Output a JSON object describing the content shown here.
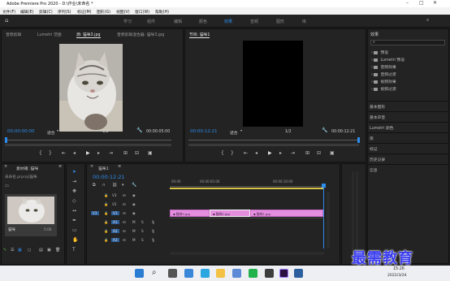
{
  "window": {
    "title": "Adobe Premiere Pro 2020 - D:\\作业\\未命名 *"
  },
  "menu": [
    "文件(F)",
    "编辑(E)",
    "剪辑(C)",
    "序列(S)",
    "标记(M)",
    "图形(G)",
    "视图(V)",
    "窗口(W)",
    "帮助(H)"
  ],
  "workspaces": [
    "学习",
    "组件",
    "编辑",
    "颜色",
    "效果",
    "音频",
    "图形",
    "库"
  ],
  "source_panel": {
    "tabs": [
      "音频剪辑",
      "Lumetri 范围",
      "源: 猫咪3.jpg",
      "音频剪辑混合器: 猫咪3.jpg"
    ],
    "timecode_in": "00:00:00:00",
    "fit": "适合",
    "fraction": "1/2",
    "timecode_out": "00:00:05:00"
  },
  "program_panel": {
    "tab": "节目: 猫咪1",
    "timecode_in": "00:00:12:21",
    "fit": "适合",
    "fraction": "1/2",
    "timecode_out": "00:00:12:21"
  },
  "effects_panel": {
    "title": "效果",
    "folders": [
      "预设",
      "Lumetri 预设",
      "音频效果",
      "音频过渡",
      "视频效果",
      "视频过渡"
    ],
    "sections": [
      "基本图形",
      "基本声音",
      "Lumetri 颜色",
      "库",
      "标记",
      "历史记录",
      "信息"
    ]
  },
  "project_panel": {
    "tab": "素材箱: 猫咪",
    "path": "未命名.prproj\\猫咪",
    "item_label": "猫咪",
    "item_duration": "5:00"
  },
  "timeline": {
    "tab": "猫咪1",
    "timecode": "00:00:12:21",
    "ruler": [
      "00:00",
      "00:00:05:00",
      "00:00:10:00"
    ],
    "video_tracks": [
      "V3",
      "V2",
      "V1"
    ],
    "audio_tracks": [
      "A1",
      "A2",
      "A3"
    ],
    "source_patch": "V1",
    "clips": [
      "猫咪3.jpg",
      "猫咪2.jpg",
      "猫咪1.jpg"
    ]
  },
  "taskbar": {
    "time": "15:26",
    "date": "2022/3/24"
  },
  "watermark": "最需教育",
  "colors": {
    "accent": "#2d8ceb",
    "clip": "#e58ee0",
    "playhead": "#2d8ceb"
  }
}
